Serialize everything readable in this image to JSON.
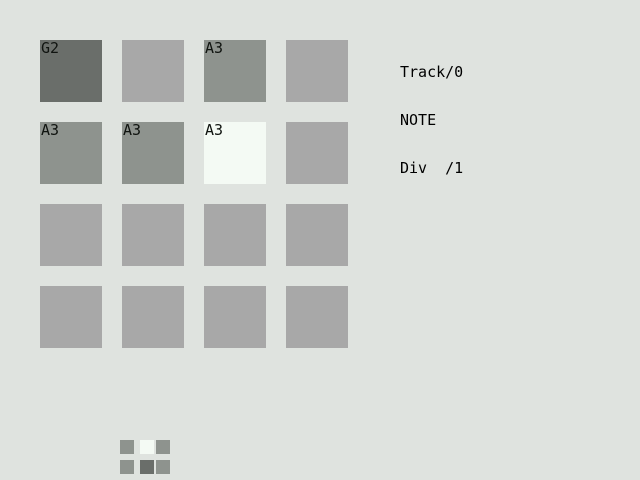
{
  "pads": [
    {
      "label": "G2",
      "state": "root"
    },
    {
      "label": "",
      "state": "off"
    },
    {
      "label": "A3",
      "state": "on"
    },
    {
      "label": "",
      "state": "off"
    },
    {
      "label": "A3",
      "state": "on"
    },
    {
      "label": "A3",
      "state": "on"
    },
    {
      "label": "A3",
      "state": "active"
    },
    {
      "label": "",
      "state": "off"
    },
    {
      "label": "",
      "state": "off"
    },
    {
      "label": "",
      "state": "off"
    },
    {
      "label": "",
      "state": "off"
    },
    {
      "label": "",
      "state": "off"
    },
    {
      "label": "",
      "state": "off"
    },
    {
      "label": "",
      "state": "off"
    },
    {
      "label": "",
      "state": "off"
    },
    {
      "label": "",
      "state": "off"
    }
  ],
  "info": {
    "track": "Track/0",
    "mode": "NOTE",
    "div": "Div  /1"
  },
  "mini_map": [
    {
      "state": "on"
    },
    {
      "state": "active"
    },
    {
      "state": "on"
    },
    {
      "state": "on"
    },
    {
      "state": "root"
    },
    {
      "state": "on"
    }
  ],
  "colors": {
    "background": "#dfe3df",
    "pad_off": "#a8a8a8",
    "pad_on": "#8e938e",
    "pad_root": "#6a6e6a",
    "pad_active": "#f4faf4"
  }
}
